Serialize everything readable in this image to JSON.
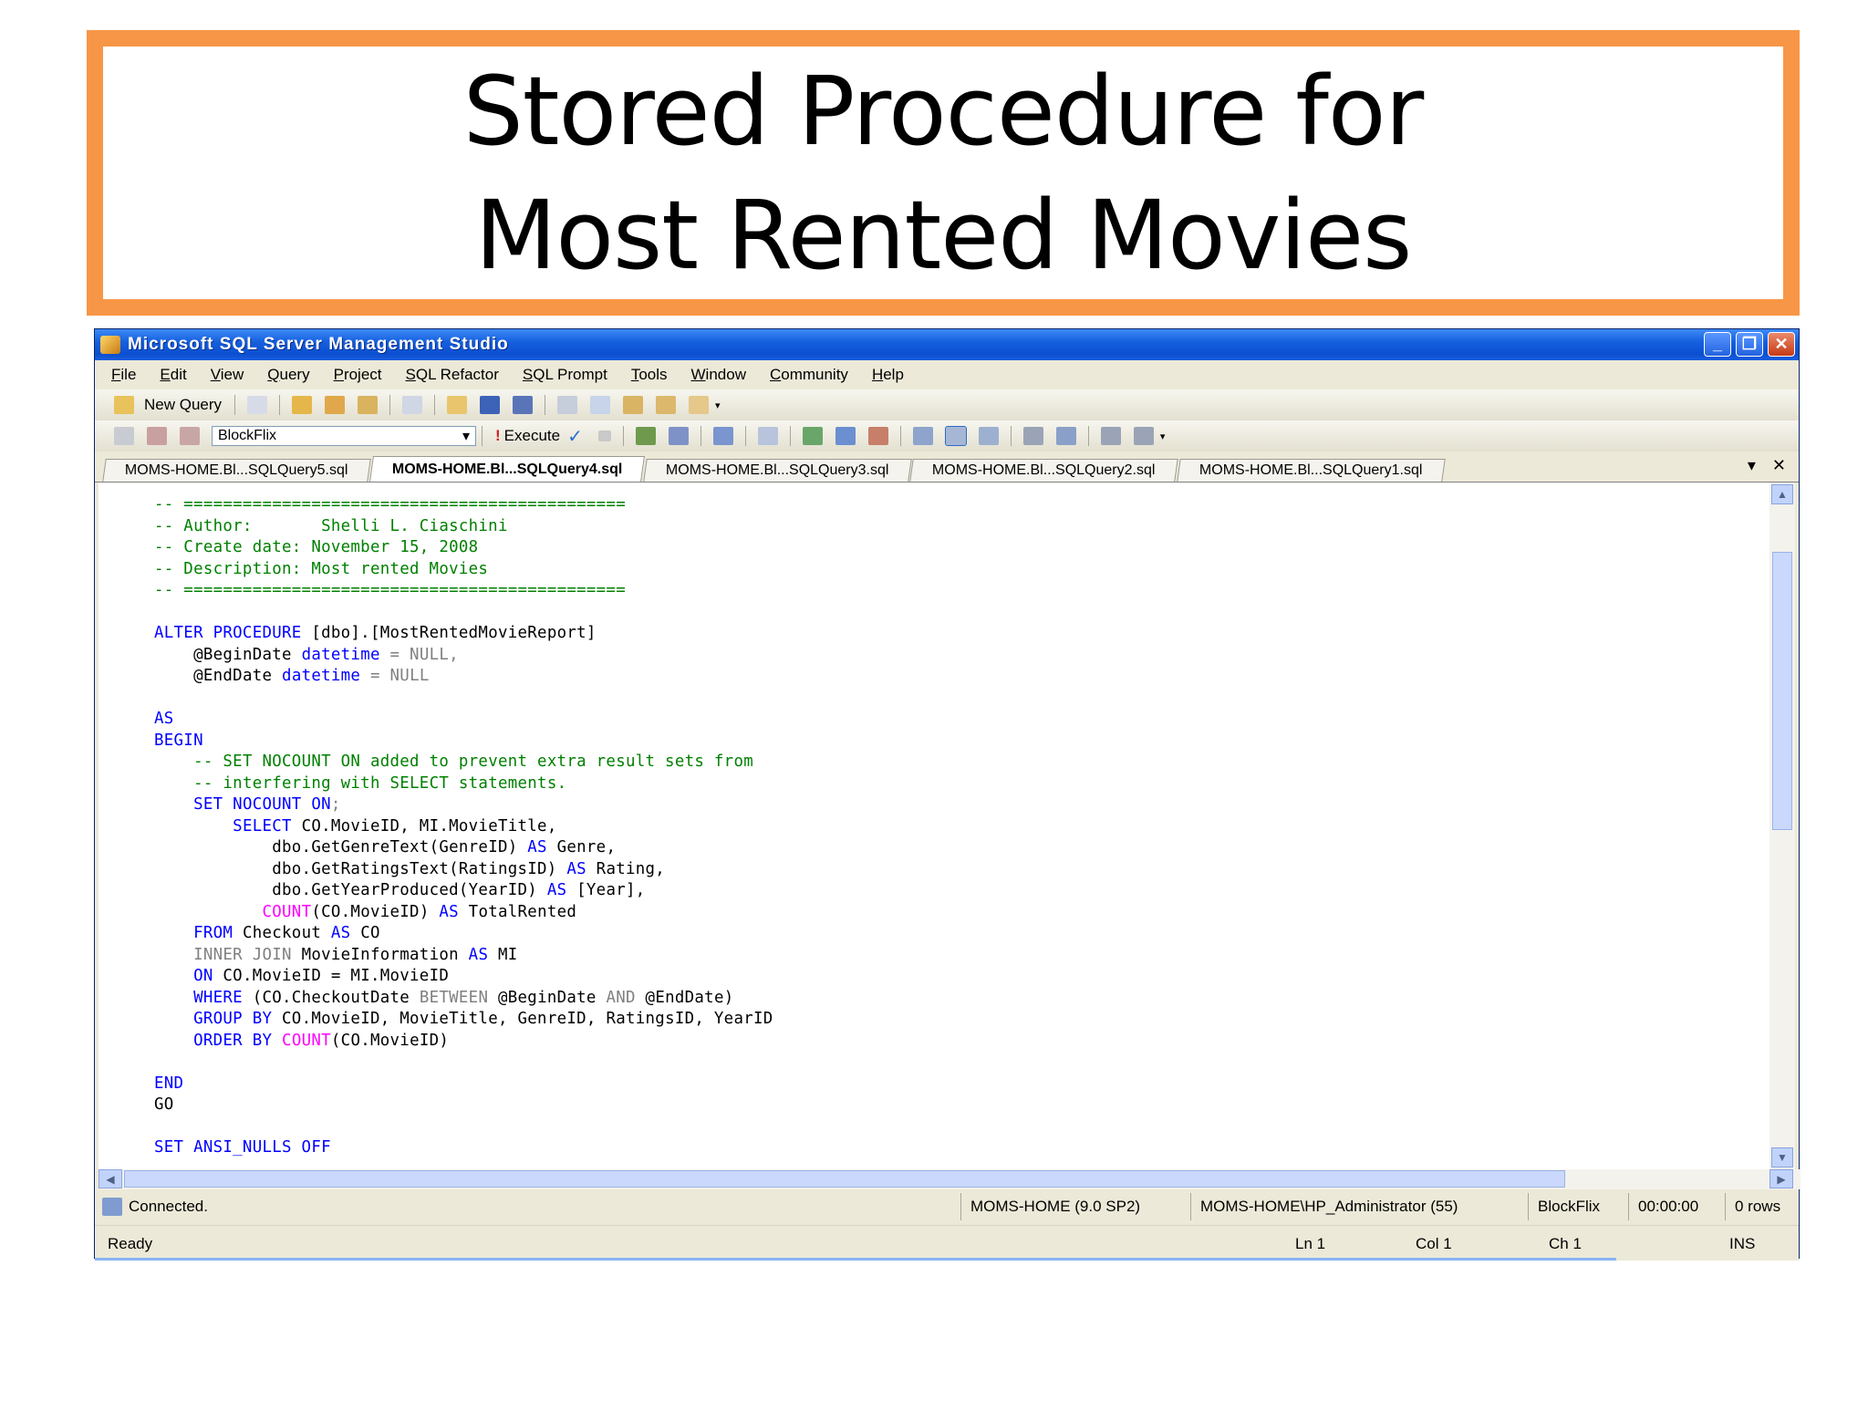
{
  "slide": {
    "title_line1": "Stored Procedure for",
    "title_line2": "Most Rented Movies"
  },
  "window": {
    "title": "Microsoft SQL Server Management Studio",
    "minimize": "_",
    "maximize": "❐",
    "close": "✕"
  },
  "menu": [
    "File",
    "Edit",
    "View",
    "Query",
    "Project",
    "SQL Refactor",
    "SQL Prompt",
    "Tools",
    "Window",
    "Community",
    "Help"
  ],
  "toolbar1": {
    "new_query": "New Query"
  },
  "toolbar2": {
    "database": "BlockFlix",
    "execute": "Execute"
  },
  "tabs": [
    "MOMS-HOME.Bl...SQLQuery5.sql",
    "MOMS-HOME.Bl...SQLQuery4.sql",
    "MOMS-HOME.Bl...SQLQuery3.sql",
    "MOMS-HOME.Bl...SQLQuery2.sql",
    "MOMS-HOME.Bl...SQLQuery1.sql"
  ],
  "tab_controls": {
    "dropdown": "▾",
    "close": "✕"
  },
  "code": {
    "l01": "-- =============================================",
    "l02": "-- Author:       Shelli L. Ciaschini",
    "l03": "-- Create date: November 15, 2008",
    "l04": "-- Description: Most rented Movies",
    "l05": "-- =============================================",
    "kw_alter_procedure": "ALTER PROCEDURE",
    "proc_name": " [dbo].[MostRentedMovieReport]",
    "param1": "@BeginDate",
    "param2": "@EndDate",
    "kw_datetime": "datetime",
    "eq_null_comma": " = NULL,",
    "eq_null": " = NULL",
    "kw_as": "AS",
    "kw_begin": "BEGIN",
    "c_nocount1": "-- SET NOCOUNT ON added to prevent extra result sets from",
    "c_nocount2": "-- interfering with SELECT statements.",
    "kw_set_nocount_on": "SET NOCOUNT ON",
    "semicolon": ";",
    "kw_select": "SELECT",
    "sel1": " CO.MovieID, MI.MovieTitle,",
    "sel2a": "dbo.GetGenreText(GenreID) ",
    "sel2b": " Genre,",
    "sel3a": "dbo.GetRatingsText(RatingsID) ",
    "sel3b": " Rating,",
    "sel4a": "dbo.GetYearProduced(YearID) ",
    "sel4b": " [Year],",
    "fn_count": "COUNT",
    "sel5a": "(CO.MovieID) ",
    "sel5b": " TotalRented",
    "kw_from": "FROM",
    "from_tbl": " Checkout ",
    "co": " CO",
    "kw_inner_join": "INNER JOIN",
    "join_tbl": " MovieInformation ",
    "mi": " MI",
    "kw_on": "ON",
    "on_cond": " CO.MovieID = MI.MovieID",
    "kw_where": "WHERE",
    "where_a": " (CO.CheckoutDate ",
    "kw_between": "BETWEEN",
    "where_b": " @BeginDate ",
    "kw_and": "AND",
    "where_c": " @EndDate)",
    "kw_group_by": "GROUP BY",
    "group_cols": " CO.MovieID, MovieTitle, GenreID, RatingsID, YearID",
    "kw_order_by": "ORDER BY",
    "order_col": "(CO.MovieID)",
    "kw_end": "END",
    "go": "GO",
    "kw_set_ansi": "SET ANSI_NULLS OFF"
  },
  "status": {
    "connected": "Connected.",
    "server": "MOMS-HOME (9.0 SP2)",
    "user": "MOMS-HOME\\HP_Administrator (55)",
    "db": "BlockFlix",
    "time": "00:00:00",
    "rows": "0 rows"
  },
  "readybar": {
    "ready": "Ready",
    "ln": "Ln 1",
    "col": "Col 1",
    "ch": "Ch 1",
    "mode": "INS"
  }
}
